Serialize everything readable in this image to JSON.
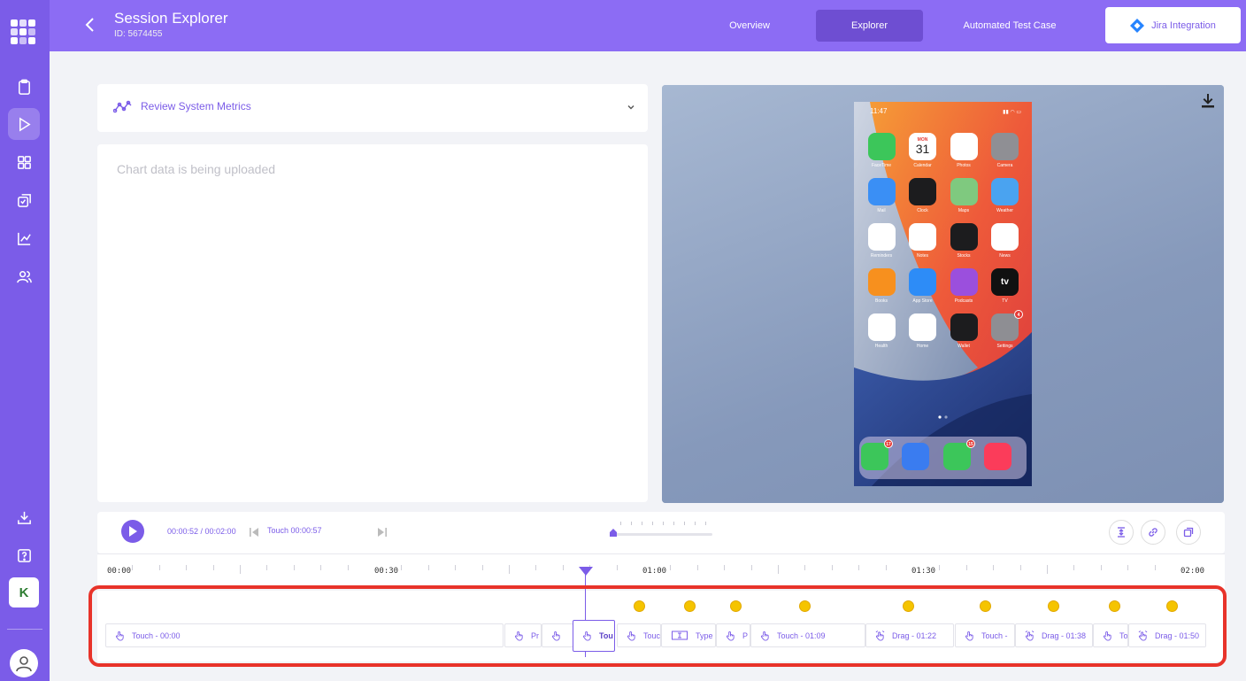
{
  "header": {
    "title": "Session Explorer",
    "session_id": "ID: 5674455",
    "tabs": [
      {
        "label": "Overview"
      },
      {
        "label": "Explorer"
      },
      {
        "label": "Automated Test Case"
      }
    ],
    "jira_label": "Jira Integration"
  },
  "sidebar": {
    "items": [
      "clipboard-icon",
      "play-icon",
      "grid-icon",
      "checklist-icon",
      "chart-icon",
      "users-icon"
    ],
    "bottom": [
      "download-icon",
      "help-icon"
    ],
    "org_badge": "K"
  },
  "metrics": {
    "label": "Review System Metrics",
    "chart_message": "Chart data is being uploaded"
  },
  "device": {
    "status_time": "11:47",
    "apps": [
      {
        "name": "FaceTime",
        "glyph": "",
        "color": "#3cc65a"
      },
      {
        "name": "Calendar",
        "glyph": "31",
        "color": "#ffffff"
      },
      {
        "name": "Photos",
        "glyph": "",
        "color": "#ffffff"
      },
      {
        "name": "Camera",
        "glyph": "",
        "color": "#8f8f94"
      },
      {
        "name": "Mail",
        "glyph": "",
        "color": "#3a8ff5"
      },
      {
        "name": "Clock",
        "glyph": "",
        "color": "#1c1c1e"
      },
      {
        "name": "Maps",
        "glyph": "",
        "color": "#7fc97f"
      },
      {
        "name": "Weather",
        "glyph": "",
        "color": "#4aa3f0"
      },
      {
        "name": "Reminders",
        "glyph": "",
        "color": "#ffffff"
      },
      {
        "name": "Notes",
        "glyph": "",
        "color": "#ffffff"
      },
      {
        "name": "Stocks",
        "glyph": "",
        "color": "#1c1c1e"
      },
      {
        "name": "News",
        "glyph": "",
        "color": "#ffffff"
      },
      {
        "name": "Books",
        "glyph": "",
        "color": "#f7901e"
      },
      {
        "name": "App Store",
        "glyph": "",
        "color": "#2d8cf7"
      },
      {
        "name": "Podcasts",
        "glyph": "",
        "color": "#9b4fdd"
      },
      {
        "name": "TV",
        "glyph": "tv",
        "color": "#111111"
      },
      {
        "name": "Health",
        "glyph": "",
        "color": "#ffffff"
      },
      {
        "name": "Home",
        "glyph": "",
        "color": "#ffffff"
      },
      {
        "name": "Wallet",
        "glyph": "",
        "color": "#1c1c1e"
      },
      {
        "name": "Settings",
        "glyph": "",
        "color": "#8e8e93",
        "badge": "4"
      }
    ],
    "calendar_day": "MON",
    "dock": [
      {
        "name": "Phone",
        "color": "#3cc65a",
        "badge": "17"
      },
      {
        "name": "Browser",
        "color": "#3a7cf0",
        "badge": ""
      },
      {
        "name": "Messages",
        "color": "#3cc65a",
        "badge": "15"
      },
      {
        "name": "Music",
        "color": "#fb3c5a",
        "badge": ""
      }
    ]
  },
  "player": {
    "time": "00:00:52 / 00:02:00",
    "current_event": "Touch 00:00:57"
  },
  "timeline": {
    "labels": [
      "00:00",
      "00:30",
      "01:00",
      "01:30",
      "02:00"
    ]
  },
  "events": [
    {
      "label": "Touch - 00:00",
      "type": "touch"
    },
    {
      "label": "Pr",
      "type": "touch"
    },
    {
      "label": "",
      "type": "touch"
    },
    {
      "label": "Tou",
      "type": "touch",
      "selected": true
    },
    {
      "label": "Touc",
      "type": "touch"
    },
    {
      "label": "Type",
      "type": "type"
    },
    {
      "label": "P",
      "type": "touch"
    },
    {
      "label": "Touch - 01:09",
      "type": "touch"
    },
    {
      "label": "Drag - 01:22",
      "type": "drag"
    },
    {
      "label": "Touch -",
      "type": "touch"
    },
    {
      "label": "Drag - 01:38",
      "type": "drag"
    },
    {
      "label": "To",
      "type": "touch"
    },
    {
      "label": "Drag - 01:50",
      "type": "drag"
    }
  ],
  "colors": {
    "accent": "#7b5ce8",
    "header": "#8c6cf4",
    "marker": "#f5c400",
    "highlight": "#e8332a"
  }
}
